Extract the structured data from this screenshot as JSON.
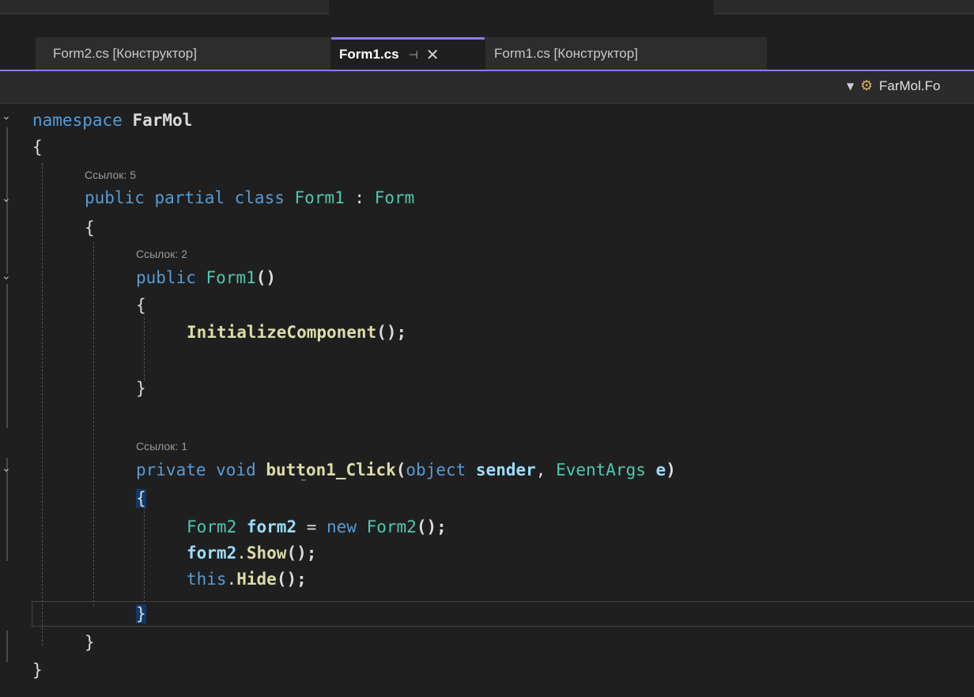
{
  "tabs": [
    {
      "label": "Form2.cs [Конструктор]",
      "active": false
    },
    {
      "label": "Form1.cs",
      "active": true,
      "pin_icon": "pin-icon",
      "close_icon": "close-icon"
    },
    {
      "label": "Form1.cs [Конструктор]",
      "active": false
    }
  ],
  "nav": {
    "member_label": "FarMol.Fo",
    "member_icon": "class-icon"
  },
  "code": {
    "ns_kw": "namespace",
    "ns_name": "FarMol",
    "brace_open": "{",
    "brace_close": "}",
    "lens_class": "Ссылок: 5",
    "class_kw": "public partial class",
    "class_name": "Form1",
    "class_colon": " : ",
    "class_base": "Form",
    "lens_ctor": "Ссылок: 2",
    "ctor_kw": "public",
    "ctor_name": "Form1",
    "ctor_parens": "()",
    "init_call": "InitializeComponent",
    "init_rest": "();",
    "lens_click": "Ссылок: 1",
    "click_kw": "private void",
    "click_name": "button1_Click",
    "click_p1": "(",
    "click_obj": "object",
    "click_sender": "sender",
    "click_comma": ", ",
    "click_type": "EventArgs",
    "click_e": "e",
    "click_p2": ")",
    "l1_type": "Form2",
    "l1_var": "form2",
    "l1_eq": " = ",
    "l1_new": "new",
    "l1_ctor": "Form2",
    "l1_end": "();",
    "l2_var": "form2",
    "l2_dot": ".",
    "l2_method": "Show",
    "l2_end": "();",
    "l3_this": "this",
    "l3_dot": ".",
    "l3_method": "Hide",
    "l3_end": "();"
  },
  "colors": {
    "accent": "#8d7cf0",
    "keyword": "#569cd6",
    "type": "#4ec9b0",
    "method": "#dcdcaa",
    "param": "#9cdcfe",
    "background": "#1f1f1f"
  }
}
